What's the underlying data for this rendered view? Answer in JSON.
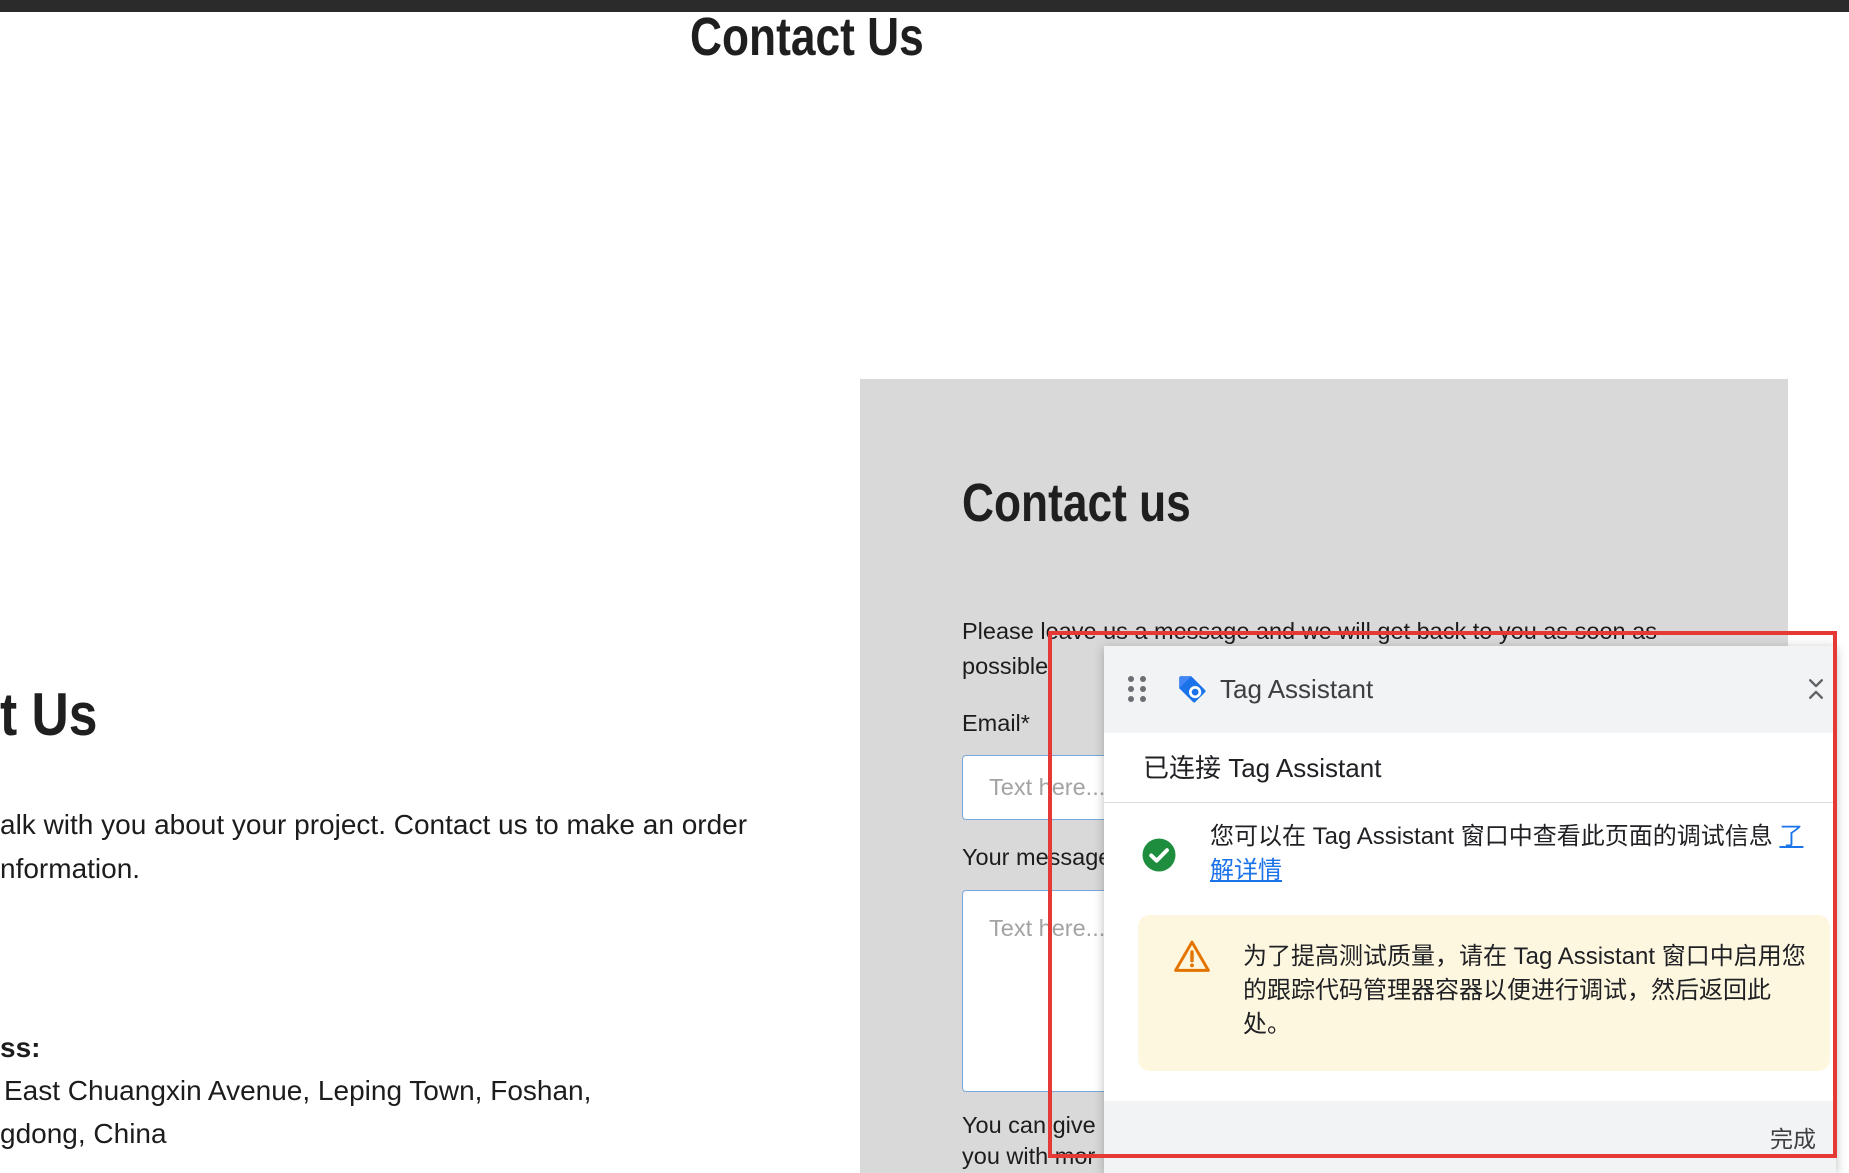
{
  "page": {
    "title": "Contact Us"
  },
  "left_column": {
    "heading": "t Us",
    "intro_lines": [
      "alk with you about your project. Contact us to make an order",
      "nformation."
    ],
    "address_label": "ss:",
    "address_lines": [
      "East Chuangxin Avenue, Leping Town, Foshan,",
      "gdong, China"
    ]
  },
  "contact_form": {
    "title": "Contact us",
    "intro_lines": [
      "Please leave us a message and we will get back to you as soon as",
      "possible"
    ],
    "email_label": "Email*",
    "email_placeholder": "Text here...",
    "message_label": "Your message",
    "message_placeholder": "Text here...",
    "note_lines": [
      "You can give",
      "you with mor"
    ]
  },
  "tag_assistant": {
    "title": "Tag Assistant",
    "connection_status": "已连接 Tag Assistant",
    "info_text": "您可以在 Tag Assistant 窗口中查看此页面的调试信息",
    "info_link": "了解详情",
    "warning_text": "为了提高测试质量，请在 Tag Assistant 窗口中启用您的跟踪代码管理器容器以便进行调试，然后返回此处。",
    "done_label": "完成"
  },
  "icons": {
    "drag_handle": "drag-handle-icon",
    "panel_logo": "tag-assistant-icon",
    "collapse": "unfold-less-icon",
    "info_status": "check-circle-icon",
    "warning": "warning-triangle-icon"
  },
  "colors": {
    "top_bar": "#2b2b2b",
    "form_panel_bg": "#d9d9d9",
    "input_border": "#7ba6dc",
    "panel_header_bg": "#f1f3f4",
    "link": "#1a73e8",
    "success": "#1e8e3e",
    "warning": "#e37400",
    "warning_bg": "#fef7e0",
    "highlight_border": "#e53935"
  }
}
